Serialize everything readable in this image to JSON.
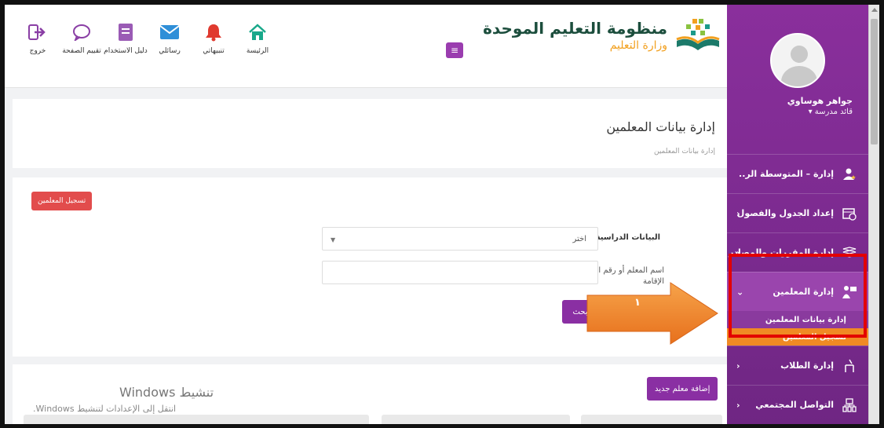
{
  "app": {
    "title": "منظومة التعليم الموحدة",
    "subtitle": "وزارة التعليم",
    "menu_toggle_label": "≡"
  },
  "toolbar": [
    {
      "label": "خروج",
      "icon": "logout-icon"
    },
    {
      "label": "تقييم الصفحة",
      "icon": "chat-bubble-icon"
    },
    {
      "label": "دليل الاستخدام",
      "icon": "book-icon"
    },
    {
      "label": "رسائلي",
      "icon": "envelope-icon"
    },
    {
      "label": "تنبيهاتي",
      "icon": "bell-icon"
    },
    {
      "label": "الرئيسة",
      "icon": "home-icon"
    }
  ],
  "user": {
    "name": "جواهر هوساوي",
    "role": "قائد مدرسة ▾"
  },
  "sidebar": {
    "items": [
      {
        "label": "إدارة – المتوسطة الر..",
        "icon": "admin-icon",
        "has_chevron": false
      },
      {
        "label": "إعداد الجدول والفصول",
        "icon": "calendar-icon",
        "has_chevron": true
      },
      {
        "label": "إدارة المقررات والمصادر",
        "icon": "books-icon",
        "has_chevron": true
      },
      {
        "label": "إدارة المعلمين",
        "icon": "teacher-icon",
        "has_chevron": true,
        "expanded": true
      },
      {
        "label": "إدارة الطلاب",
        "icon": "student-icon",
        "has_chevron": true
      },
      {
        "label": "التواصل المجتمعي",
        "icon": "community-icon",
        "has_chevron": true
      }
    ],
    "subitems": [
      {
        "label": "إدارة بيانات المعلمين"
      },
      {
        "label": "تسجيل المعلمين"
      }
    ]
  },
  "page": {
    "title": "إدارة بيانات المعلمين",
    "breadcrumb": "إدارة بيانات المعلمين"
  },
  "search": {
    "register_button": "تسجيل المعلمين",
    "academic_label": "البيانات الدراسية",
    "academic_value": "اختر",
    "name_label": "اسم المعلم أو رقم الهوية/ الإقامة",
    "name_value": "",
    "search_button": "بحث"
  },
  "annotation": {
    "step_number": "١"
  },
  "list": {
    "add_button": "إضافة معلم جديد"
  },
  "watermark": {
    "title": "تنشيط Windows",
    "subtitle": "انتقل إلى الإعدادات لتنشيط Windows."
  },
  "colors": {
    "sidebar": "#7a2a8e",
    "accent_purple": "#8a2fa3",
    "danger_red": "#e24c4c",
    "highlight_orange": "#f08a24",
    "annotation_red": "#e30000"
  }
}
